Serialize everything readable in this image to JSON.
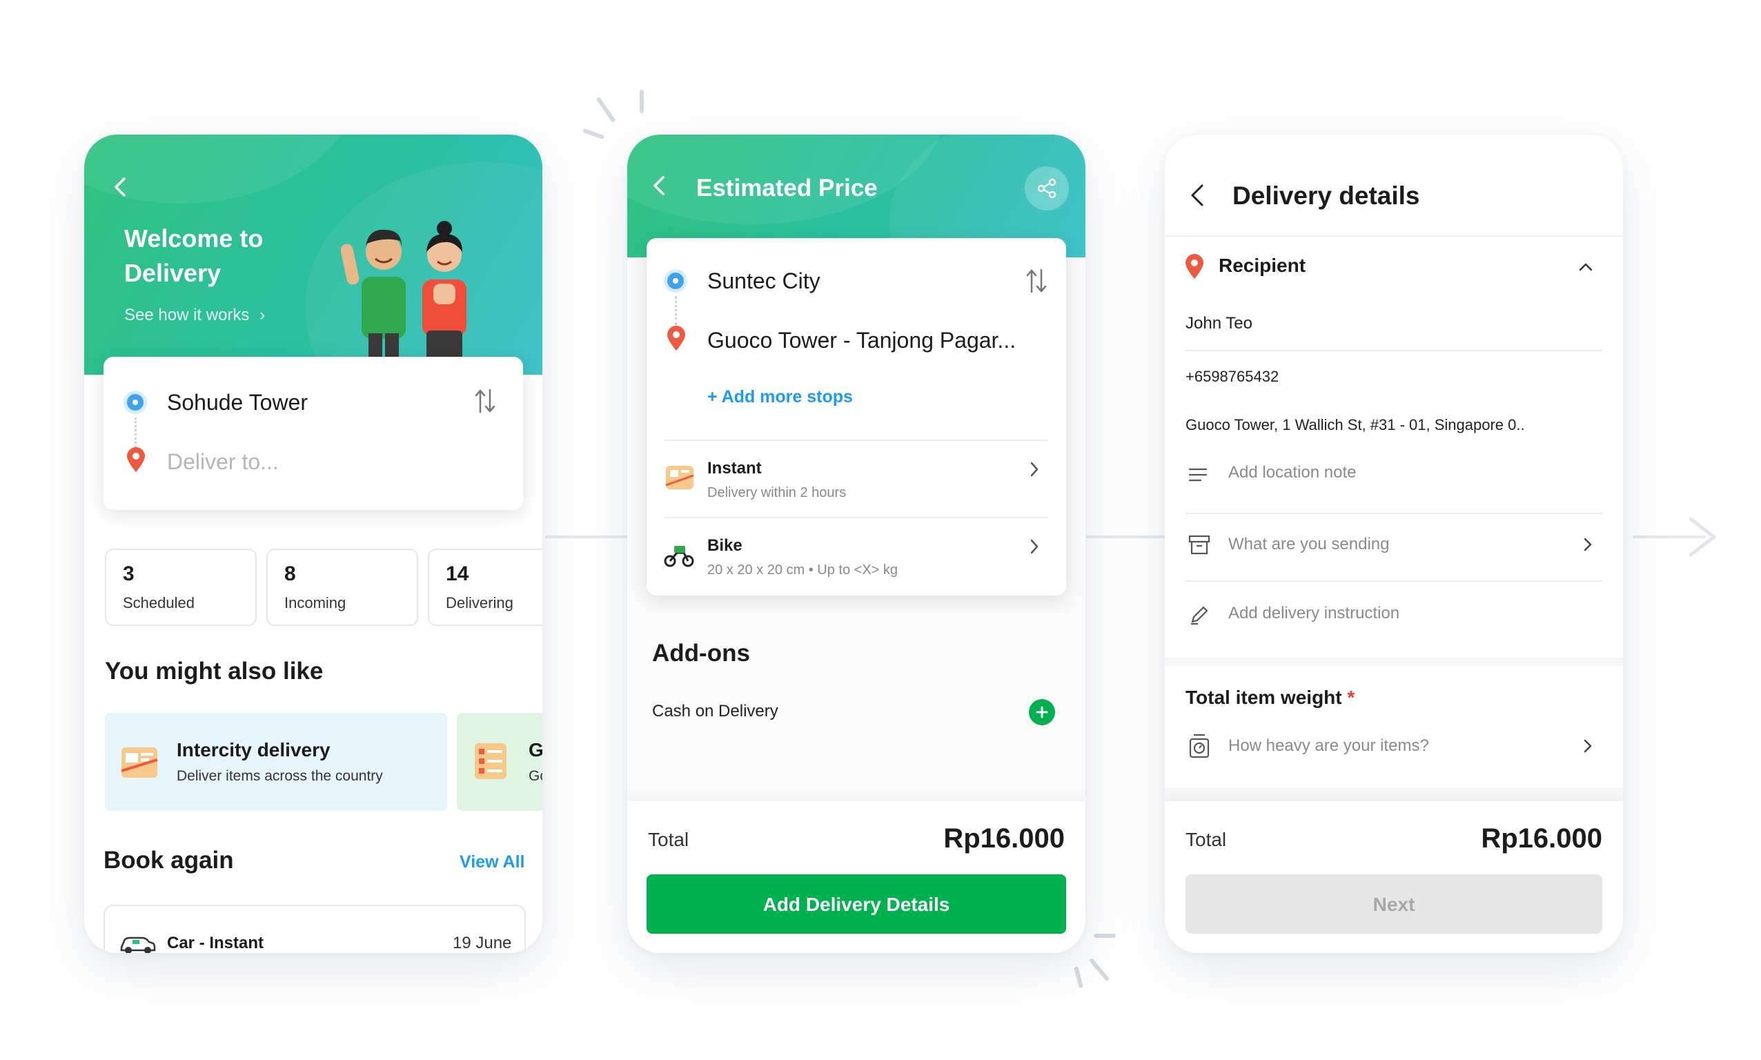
{
  "screen1": {
    "hero_title_line1": "Welcome to",
    "hero_title_line2": "Delivery",
    "hero_link": "See how it works",
    "pickup": "Sohude Tower",
    "dropoff_placeholder": "Deliver to...",
    "stats": [
      {
        "count": "3",
        "label": "Scheduled"
      },
      {
        "count": "8",
        "label": "Incoming"
      },
      {
        "count": "14",
        "label": "Delivering"
      }
    ],
    "suggest_heading": "You might also like",
    "suggest_cards": [
      {
        "title": "Intercity delivery",
        "subtitle": "Deliver items across the country"
      },
      {
        "title": "G",
        "subtitle": "Gc"
      }
    ],
    "book_again_heading": "Book again",
    "view_all": "View All",
    "recent": {
      "service": "Car - Instant",
      "date": "19 June"
    }
  },
  "screen2": {
    "title": "Estimated Price",
    "pickup": "Suntec City",
    "dropoff": "Guoco Tower - Tanjong Pagar...",
    "add_stops": "+ Add more stops",
    "options": [
      {
        "name": "Instant",
        "detail": "Delivery within 2 hours",
        "icon": "instant-box-icon"
      },
      {
        "name": "Bike",
        "detail": "20 x 20 x 20 cm • Up to <X> kg",
        "icon": "bike-icon"
      }
    ],
    "addons_heading": "Add-ons",
    "addon_item": "Cash on Delivery",
    "total_label": "Total",
    "total_value": "Rp16.000",
    "cta": "Add Delivery Details"
  },
  "screen3": {
    "title": "Delivery details",
    "section": "Recipient",
    "name": "John Teo",
    "phone": "+6598765432",
    "address": "Guoco Tower, 1 Wallich St, #31 - 01, Singapore 0..",
    "location_note": "Add location note",
    "sending": "What are you sending",
    "instruction": "Add delivery instruction",
    "weight_heading": "Total item weight",
    "weight_required": "*",
    "weight_prompt": "How heavy are your items?",
    "total_label": "Total",
    "total_value": "Rp16.000",
    "cta": "Next"
  },
  "colors": {
    "brand_green": "#00b14f",
    "header_gradient_start": "#2fc27f",
    "header_gradient_end": "#35c0c6",
    "link_blue": "#1d9bf0",
    "pin_red": "#ee5a3f",
    "pickup_blue": "#3ea3ea"
  }
}
